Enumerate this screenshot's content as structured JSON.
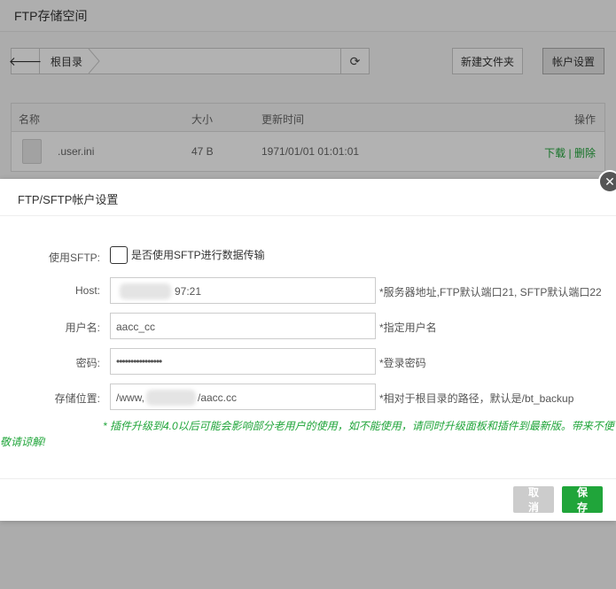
{
  "page": {
    "title": "FTP存储空间"
  },
  "toolbar": {
    "crumb": "根目录",
    "new_folder_label": "新建文件夹",
    "account_settings_label": "帐户设置"
  },
  "table": {
    "headers": {
      "name": "名称",
      "size": "大小",
      "modified": "更新时间",
      "ops": "操作"
    },
    "rows": [
      {
        "name": ".user.ini",
        "size": "47 B",
        "modified": "1971/01/01 01:01:01",
        "download": "下载",
        "sep": "|",
        "delete": "删除"
      }
    ]
  },
  "modal": {
    "title": "FTP/SFTP帐户设置",
    "sftp": {
      "label": "使用SFTP:",
      "checkbox_label": "是否使用SFTP进行数据传输",
      "checked": false
    },
    "host": {
      "label": "Host:",
      "value": "97:21",
      "hint": "*服务器地址,FTP默认端口21, SFTP默认端口22"
    },
    "username": {
      "label": "用户名:",
      "value": "aacc_cc",
      "hint": "*指定用户名"
    },
    "password": {
      "label": "密码:",
      "value": "••••••••••••••••",
      "hint": "*登录密码"
    },
    "storage": {
      "label": "存储位置:",
      "prefix": "/www,",
      "suffix": "/aacc.cc",
      "hint": "*相对于根目录的路径，默认是/bt_backup"
    },
    "notice_line1": "* 插件升级到4.0以后可能会影响部分老用户的使用，如不能使用，请同时升级面板和插件到最新版。带来不便",
    "notice_line2": "敬请谅解!",
    "cancel_label": "取消",
    "save_label": "保存"
  },
  "colors": {
    "accent": "#20a53a",
    "cancel": "#cccccc"
  }
}
